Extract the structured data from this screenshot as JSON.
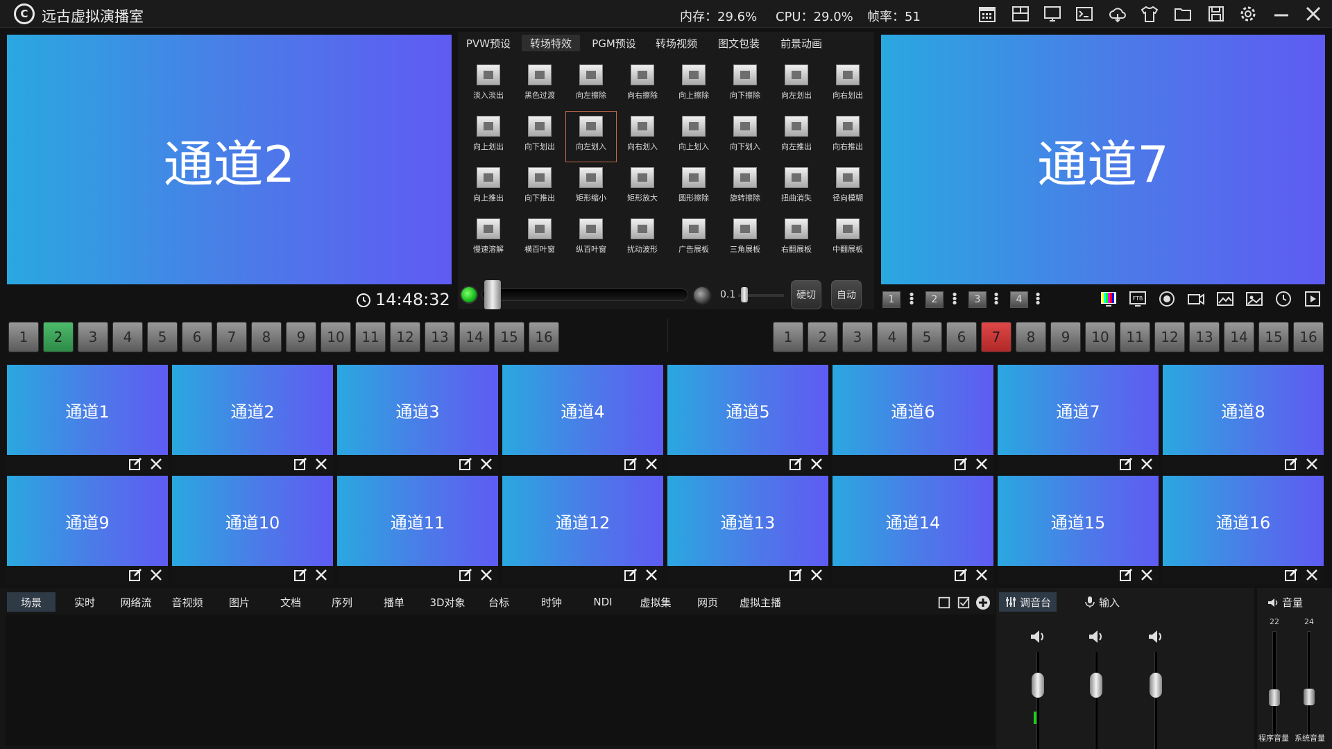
{
  "app": {
    "title": "远古虚拟演播室",
    "logo_letter": "C",
    "stats": {
      "memory": "内存：29.6%",
      "cpu": "CPU：29.0%",
      "fps": "帧率：51"
    },
    "toolbar_icons": [
      "calendar-icon",
      "layout-icon",
      "monitor-icon",
      "terminal-icon",
      "cloud-icon",
      "shirt-icon",
      "folder-icon",
      "save-icon",
      "gear-icon",
      "minimize-icon",
      "close-icon"
    ]
  },
  "pvw": {
    "label": "通道2",
    "time": "14:48:32"
  },
  "pgm": {
    "label": "通道7"
  },
  "effects": {
    "tabs": [
      "PVW预设",
      "转场特效",
      "PGM预设",
      "转场视频",
      "图文包装",
      "前景动画"
    ],
    "active_tab": 1,
    "items": [
      "淡入淡出",
      "黑色过渡",
      "向左擦除",
      "向右擦除",
      "向上擦除",
      "向下擦除",
      "向左划出",
      "向右划出",
      "向上划出",
      "向下划出",
      "向左划入",
      "向右划入",
      "向上划入",
      "向下划入",
      "向左推出",
      "向右推出",
      "向上推出",
      "向下推出",
      "矩形缩小",
      "矩形放大",
      "圆形擦除",
      "旋转擦除",
      "扭曲消失",
      "径向模糊",
      "慢速溶解",
      "横百叶窗",
      "纵百叶窗",
      "扰动波形",
      "广告展板",
      "三角展板",
      "右翻展板",
      "中翻展板"
    ],
    "selected_index": 10,
    "speed": "0.1",
    "buttons": {
      "cut": "硬切",
      "auto": "自动"
    }
  },
  "mini_buttons": [
    "1",
    "2",
    "3",
    "4"
  ],
  "pvw_numbers": [
    "1",
    "2",
    "3",
    "4",
    "5",
    "6",
    "7",
    "8",
    "9",
    "10",
    "11",
    "12",
    "13",
    "14",
    "15",
    "16"
  ],
  "pvw_active": 2,
  "pgm_numbers": [
    "1",
    "2",
    "3",
    "4",
    "5",
    "6",
    "7",
    "8",
    "9",
    "10",
    "11",
    "12",
    "13",
    "14",
    "15",
    "16"
  ],
  "pgm_active": 7,
  "channels": [
    "通道1",
    "通道2",
    "通道3",
    "通道4",
    "通道5",
    "通道6",
    "通道7",
    "通道8",
    "通道9",
    "通道10",
    "通道11",
    "通道12",
    "通道13",
    "通道14",
    "通道15",
    "通道16"
  ],
  "bottom_tabs": [
    "场景",
    "实时",
    "网络流",
    "音视频",
    "图片",
    "文档",
    "序列",
    "播单",
    "3D对象",
    "台标",
    "时钟",
    "NDI",
    "虚拟集",
    "网页",
    "虚拟主播"
  ],
  "bottom_active": 0,
  "mixer": {
    "tab_mixer": "调音台",
    "tab_input": "输入"
  },
  "volume": {
    "title": "音量",
    "program": {
      "label": "程序音量",
      "value": "22"
    },
    "system": {
      "label": "系统音量",
      "value": "24"
    }
  }
}
